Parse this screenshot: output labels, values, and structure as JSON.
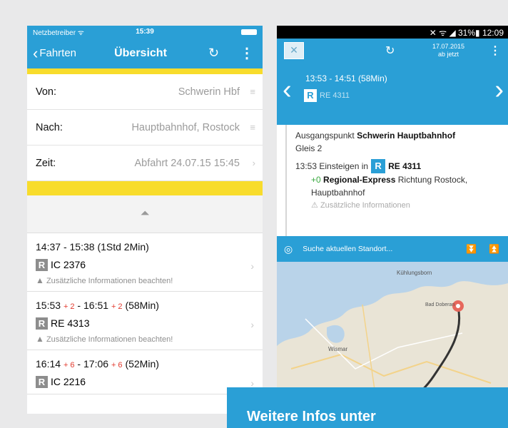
{
  "colors": {
    "accent": "#2a9fd6",
    "yellow": "#f8dc2c",
    "delay": "#e23a2e",
    "badge_gray": "#8d8d8d"
  },
  "ios": {
    "status": {
      "carrier": "Netzbetreiber ᯤ",
      "time": "15:39"
    },
    "nav": {
      "back_label": "Fahrten",
      "title": "Übersicht",
      "refresh_icon": "refresh-icon",
      "menu_icon": "more-vertical-icon"
    },
    "form": [
      {
        "label": "Von:",
        "value": "Schwerin Hbf",
        "trail": "≡"
      },
      {
        "label": "Nach:",
        "value": "Hauptbahnhof, Rostock",
        "trail": "≡"
      },
      {
        "label": "Zeit:",
        "value": "Abfahrt 24.07.15 15:45",
        "trail": "›"
      }
    ],
    "connections": [
      {
        "start": "14:37",
        "start_delay": "",
        "end": "15:38",
        "end_delay": "",
        "duration": "(1Std 2Min)",
        "badge": "R",
        "train": "IC 2376",
        "warning": "Zusätzliche Informationen beachten!"
      },
      {
        "start": "15:53",
        "start_delay": "+ 2",
        "end": "16:51",
        "end_delay": "+ 2",
        "duration": "(58Min)",
        "badge": "R",
        "train": "RE 4313",
        "warning": "Zusätzliche Informationen beachten!"
      },
      {
        "start": "16:14",
        "start_delay": "+ 6",
        "end": "17:06",
        "end_delay": "+ 6",
        "duration": "(52Min)",
        "badge": "R",
        "train": "IC 2216",
        "warning": ""
      }
    ]
  },
  "android": {
    "status": {
      "text": "✕  ᯤ  ◢ 31%▮ 12:09"
    },
    "bar": {
      "date": "17.07.2015",
      "date_sub": "ab jetzt"
    },
    "hero": {
      "time": "13:53 - 14:51 (58Min)",
      "badge": "R",
      "train": "RE 4311"
    },
    "detail": {
      "start_label": "Ausgangspunkt",
      "start_value": "Schwerin Hauptbahnhof",
      "platform": "Gleis 2",
      "step_time": "13:53 Einsteigen in",
      "step_badge": "R",
      "step_train": "RE 4311",
      "delay": "+0",
      "train_type": "Regional-Express",
      "direction_label": "Richtung",
      "direction_value": "Rostock, Hauptbahnhof",
      "info": "Zusätzliche Informationen"
    },
    "search": {
      "label": "Suche aktuellen Standort..."
    },
    "map": {
      "labels": [
        "Kühlungsborn",
        "Bad Doberan",
        "Wismar"
      ]
    }
  },
  "infobox": {
    "text": "Weitere Infos unter"
  }
}
